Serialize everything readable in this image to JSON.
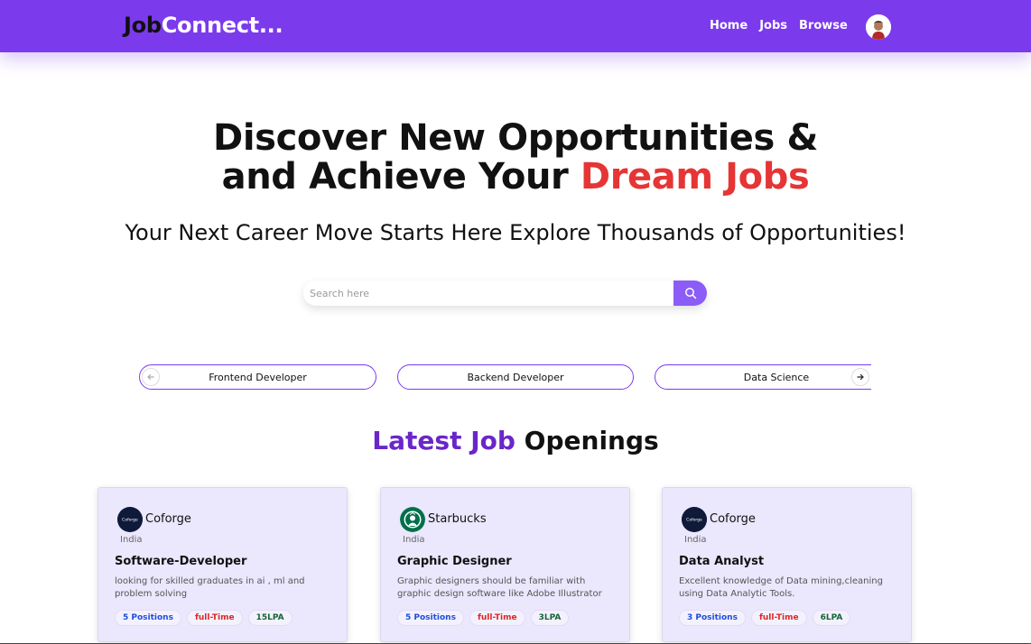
{
  "header": {
    "logo_part1": "Job",
    "logo_part2": "Connect...",
    "nav": [
      "Home",
      "Jobs",
      "Browse"
    ]
  },
  "hero": {
    "title_line1": "Discover New Opportunities &",
    "title_line2_plain": "and Achieve Your ",
    "title_line2_accent": "Dream Jobs",
    "subtitle": "Your Next Career Move Starts Here Explore Thousands of Opportunities!"
  },
  "search": {
    "placeholder": "Search here"
  },
  "categories": [
    "Frontend Developer",
    "Backend Developer",
    "Data Science"
  ],
  "section": {
    "title_part1": "Latest ",
    "title_part2": "Job",
    "title_part3": " Openings"
  },
  "jobs": [
    {
      "company": "Coforge",
      "logo_text": "Coforge",
      "location": "India",
      "title": "Software-Developer",
      "description": "looking for skilled graduates in ai , ml and problem solving",
      "positions": "5 Positions",
      "type": "full-Time",
      "salary": "15LPA"
    },
    {
      "company": "Starbucks",
      "location": "India",
      "title": "Graphic Designer",
      "description": "Graphic designers should be familiar with graphic design software like Adobe Illustrator",
      "positions": "5 Positions",
      "type": "full-Time",
      "salary": "3LPA"
    },
    {
      "company": "Coforge",
      "logo_text": "Coforge",
      "location": "India",
      "title": "Data Analyst",
      "description": "Excellent knowledge of Data mining,cleaning using Data Analytic Tools.",
      "positions": "3 Positions",
      "type": "full-Time",
      "salary": "6LPA"
    }
  ],
  "colors": {
    "brand": "#7c3aed",
    "accent": "#e53535",
    "section_accent": "#6a26c9",
    "card_bg": "#ebe7fd"
  },
  "icons": {
    "search": "search-icon",
    "prev": "arrow-left-icon",
    "next": "arrow-right-icon",
    "avatar": "user-avatar"
  }
}
